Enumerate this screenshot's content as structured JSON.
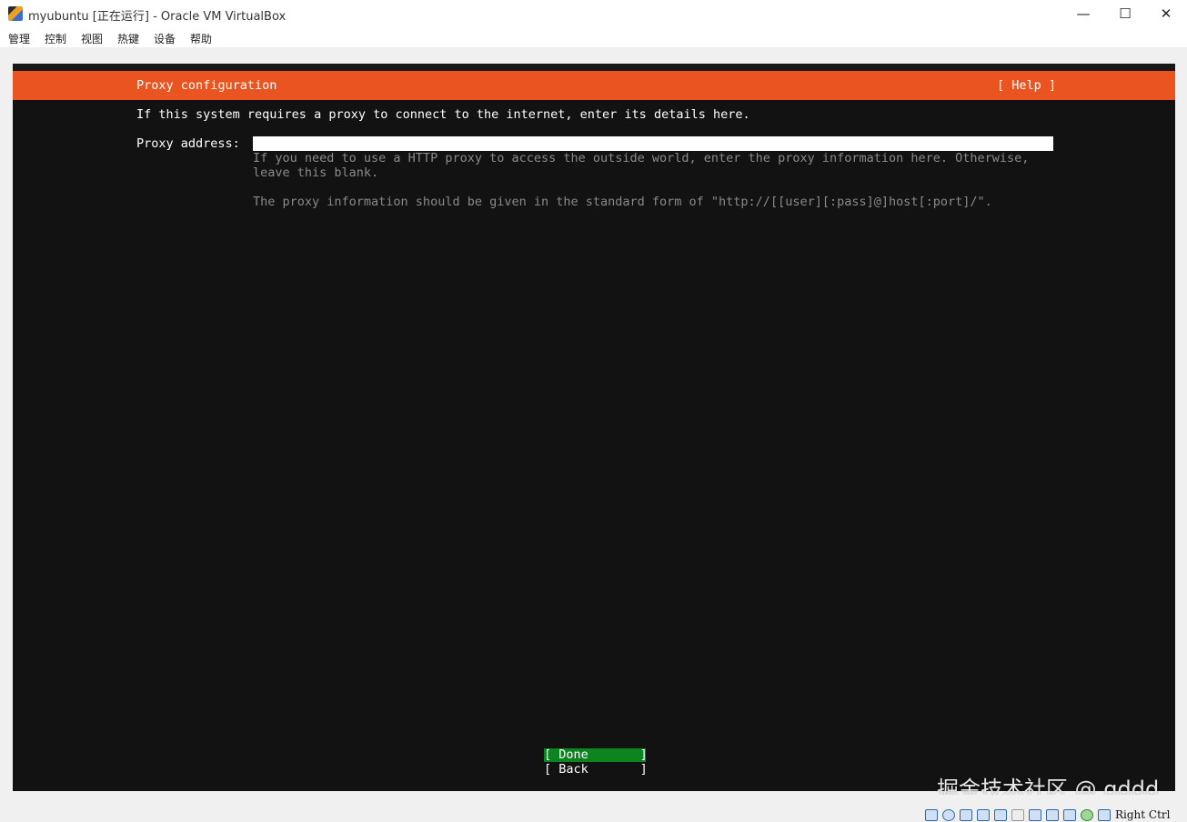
{
  "window": {
    "title": "myubuntu [正在运行] - Oracle VM VirtualBox",
    "controls": {
      "minimize": "—",
      "maximize": "☐",
      "close": "✕"
    }
  },
  "menu": [
    "管理",
    "控制",
    "视图",
    "热键",
    "设备",
    "帮助"
  ],
  "installer": {
    "header_title": "Proxy configuration",
    "help_button": "[ Help ]",
    "intro": "If this system requires a proxy to connect to the internet, enter its details here.",
    "proxy_label": "Proxy address:",
    "proxy_value": "",
    "hint_line1": "If you need to use a HTTP proxy to access the outside world, enter the proxy information here. Otherwise,",
    "hint_line2": "leave this blank.",
    "hint_line3": "The proxy information should be given in the standard form of \"http://[[user][:pass]@]host[:port]/\".",
    "buttons": {
      "done": "[ Done       ]",
      "back": "[ Back       ]"
    },
    "accent_color": "#e95420",
    "selected_color": "#0e8420"
  },
  "watermark": "掘金技术社区 @ qddd",
  "statusbar": {
    "icons": [
      "hard-disk-icon",
      "optical-drive-icon",
      "audio-icon",
      "network-icon",
      "usb-icon",
      "shared-folder-icon",
      "display-icon",
      "recording-icon",
      "cpu-icon",
      "mouse-integration-icon",
      "keyboard-icon"
    ],
    "host_key": "Right Ctrl"
  }
}
